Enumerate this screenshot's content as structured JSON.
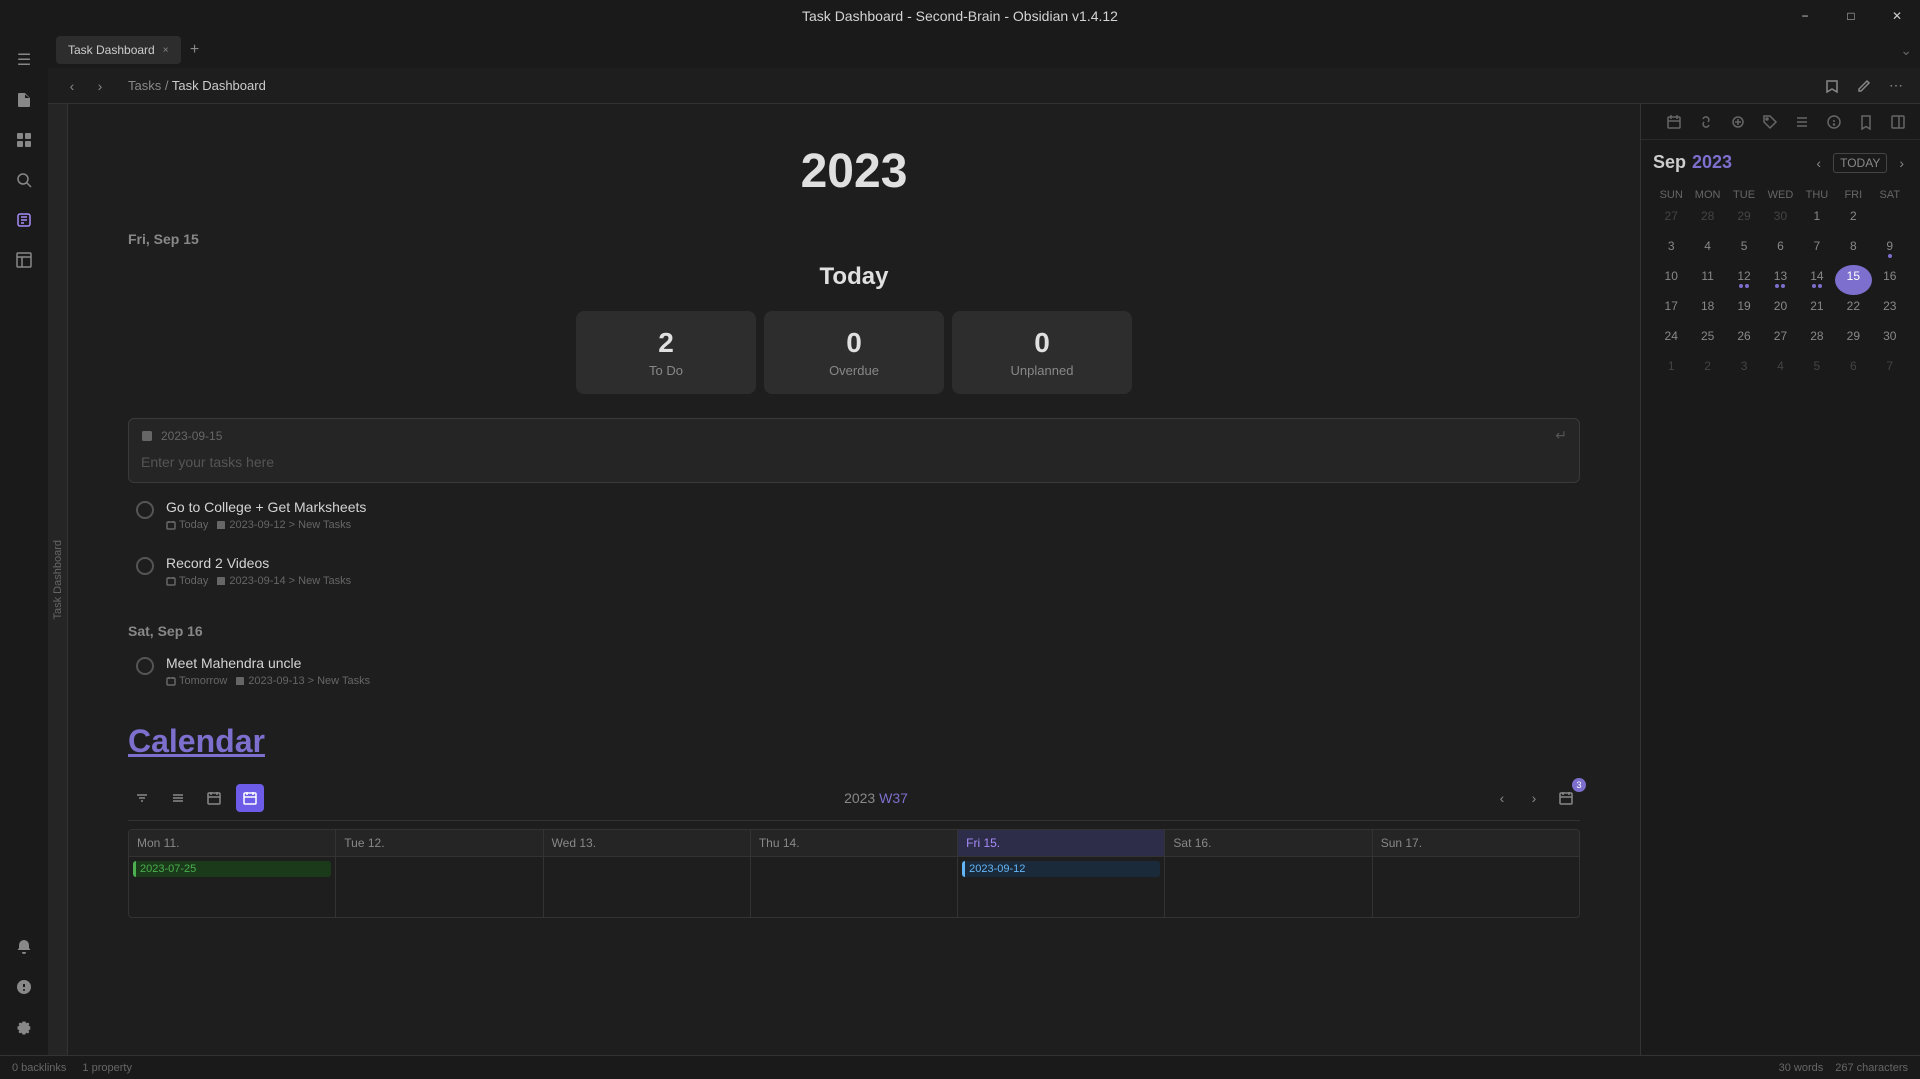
{
  "window": {
    "title": "Task Dashboard - Second-Brain - Obsidian v1.4.12"
  },
  "window_controls": {
    "minimize": "−",
    "maximize": "□",
    "close": "✕"
  },
  "sidebar": {
    "icons": [
      {
        "name": "open-sidebar-icon",
        "glyph": "☰",
        "active": false
      },
      {
        "name": "new-file-icon",
        "glyph": "📄",
        "active": false
      },
      {
        "name": "dashboard-icon",
        "glyph": "⊞",
        "active": false
      },
      {
        "name": "search-icon",
        "glyph": "⌕",
        "active": false
      },
      {
        "name": "tasks-icon",
        "glyph": "✓",
        "active": true
      },
      {
        "name": "table-icon",
        "glyph": "⊟",
        "active": false
      },
      {
        "name": "graph-icon",
        "glyph": "⋰",
        "active": false
      }
    ],
    "bottom_icons": [
      {
        "name": "notification-icon",
        "glyph": "🔔"
      },
      {
        "name": "help-icon",
        "glyph": "?"
      },
      {
        "name": "settings-icon",
        "glyph": "⚙"
      }
    ]
  },
  "tab": {
    "label": "Task Dashboard",
    "close": "×"
  },
  "tab_add": "+",
  "toolbar": {
    "nav_back": "‹",
    "nav_forward": "›",
    "breadcrumb_parent": "Tasks",
    "breadcrumb_sep": "/",
    "breadcrumb_current": "Task Dashboard",
    "bookmark_icon": "🔖",
    "edit_icon": "✏",
    "more_icon": "⋯",
    "dropdown_icon": "⌄"
  },
  "vertical_tab_label": "Task Dashboard",
  "content": {
    "year": "2023",
    "fri_date_label": "Fri, Sep 15",
    "today_heading": "Today",
    "stats": [
      {
        "number": "2",
        "label": "To Do"
      },
      {
        "number": "0",
        "label": "Overdue"
      },
      {
        "number": "0",
        "label": "Unplanned"
      }
    ],
    "task_input": {
      "date": "2023-09-15",
      "placeholder": "Enter your tasks here",
      "enter_glyph": "↵"
    },
    "tasks_fri": [
      {
        "title": "Go to College + Get Marksheets",
        "meta_date": "Today",
        "meta_file": "2023-09-12 > New Tasks"
      },
      {
        "title": "Record 2 Videos",
        "meta_date": "Today",
        "meta_file": "2023-09-14 > New Tasks"
      }
    ],
    "sat_date_label": "Sat, Sep 16",
    "tasks_sat": [
      {
        "title": "Meet Mahendra uncle",
        "meta_date": "Tomorrow",
        "meta_file": "2023-09-13 > New Tasks"
      }
    ],
    "calendar_link": "Calendar",
    "calendar_toolbar": {
      "filter_icon": "⊟",
      "list_icon": "☰",
      "cal_icon": "📅",
      "week_icon": "📅",
      "week_label": "2023",
      "week_number": "W37",
      "nav_prev": "‹",
      "nav_next": "›",
      "today_icon": "⊕",
      "badge": "3"
    },
    "calendar_week": {
      "days": [
        {
          "label": "Mon 11.",
          "events": [
            {
              "text": "2023-07-25",
              "type": "green"
            }
          ]
        },
        {
          "label": "Tue 12.",
          "events": []
        },
        {
          "label": "Wed 13.",
          "events": []
        },
        {
          "label": "Thu 14.",
          "events": []
        },
        {
          "label": "Fri 15.",
          "events": [
            {
              "text": "2023-09-12",
              "type": "blue"
            }
          ],
          "today": true
        },
        {
          "label": "Sat 16.",
          "events": []
        },
        {
          "label": "Sun 17.",
          "events": []
        }
      ]
    }
  },
  "right_sidebar": {
    "toolbar_icons": [
      "⊞",
      "🔗",
      "🔍",
      "🏷",
      "☰",
      "ℹ",
      "🏦",
      "▦"
    ],
    "mini_cal": {
      "month": "Sep",
      "year": "2023",
      "today_btn": "TODAY",
      "prev": "‹",
      "next": "›",
      "days_of_week": [
        "SUN",
        "MON",
        "TUE",
        "WED",
        "THU",
        "FRI",
        "SAT"
      ],
      "weeks": [
        [
          {
            "d": "27",
            "other": true
          },
          {
            "d": "28",
            "other": true
          },
          {
            "d": "29",
            "other": true
          },
          {
            "d": "30",
            "other": true
          },
          {
            "d": "1"
          },
          {
            "d": "2"
          }
        ],
        [
          {
            "d": "3"
          },
          {
            "d": "4"
          },
          {
            "d": "5"
          },
          {
            "d": "6"
          },
          {
            "d": "7"
          },
          {
            "d": "8"
          },
          {
            "d": "9",
            "dot": true
          }
        ],
        [
          {
            "d": "10"
          },
          {
            "d": "11"
          },
          {
            "d": "12",
            "dots": 2
          },
          {
            "d": "13",
            "dots": 2
          },
          {
            "d": "14",
            "dots": 2
          },
          {
            "d": "15",
            "today": true,
            "dots": 1
          },
          {
            "d": "16"
          }
        ],
        [
          {
            "d": "17"
          },
          {
            "d": "18"
          },
          {
            "d": "19"
          },
          {
            "d": "20"
          },
          {
            "d": "21"
          },
          {
            "d": "22"
          },
          {
            "d": "23"
          }
        ],
        [
          {
            "d": "24"
          },
          {
            "d": "25"
          },
          {
            "d": "26"
          },
          {
            "d": "27"
          },
          {
            "d": "28"
          },
          {
            "d": "29"
          },
          {
            "d": "30"
          }
        ],
        [
          {
            "d": "1",
            "other": true
          },
          {
            "d": "2",
            "other": true
          },
          {
            "d": "3",
            "other": true
          },
          {
            "d": "4",
            "other": true
          },
          {
            "d": "5",
            "other": true
          },
          {
            "d": "6",
            "other": true
          },
          {
            "d": "7",
            "other": true
          }
        ]
      ]
    }
  },
  "statusbar": {
    "backlinks": "0 backlinks",
    "property": "1 property",
    "words": "30 words",
    "chars": "267 characters"
  }
}
